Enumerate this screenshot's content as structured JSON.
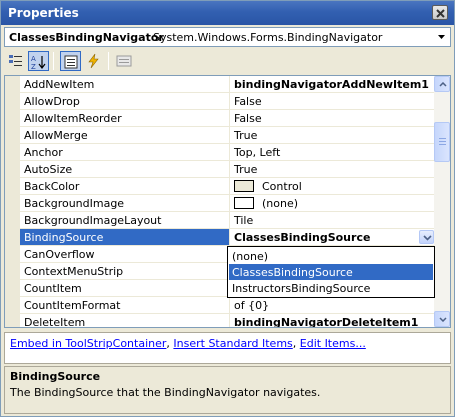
{
  "window": {
    "title": "Properties"
  },
  "object_selector": {
    "name": "ClassesBindingNavigator",
    "type": "System.Windows.Forms.BindingNavigator"
  },
  "toolbar": {
    "buttons": [
      "categorized-icon",
      "alphabetical-icon",
      "properties-icon",
      "events-icon",
      "property-pages-icon"
    ]
  },
  "properties": [
    {
      "name": "AddNewItem",
      "value": "bindingNavigatorAddNewItem1",
      "bold": true
    },
    {
      "name": "AllowDrop",
      "value": "False"
    },
    {
      "name": "AllowItemReorder",
      "value": "False"
    },
    {
      "name": "AllowMerge",
      "value": "True"
    },
    {
      "name": "Anchor",
      "value": "Top, Left"
    },
    {
      "name": "AutoSize",
      "value": "True"
    },
    {
      "name": "BackColor",
      "value": "Control",
      "swatch": "#ece9d8"
    },
    {
      "name": "BackgroundImage",
      "value": "(none)",
      "swatch": "#ffffff"
    },
    {
      "name": "BackgroundImageLayout",
      "value": "Tile"
    },
    {
      "name": "BindingSource",
      "value": "ClassesBindingSource",
      "bold": true,
      "selected": true
    },
    {
      "name": "CanOverflow",
      "value": ""
    },
    {
      "name": "ContextMenuStrip",
      "value": ""
    },
    {
      "name": "CountItem",
      "value": ""
    },
    {
      "name": "CountItemFormat",
      "value": "of {0}"
    },
    {
      "name": "DeleteItem",
      "value": "bindingNavigatorDeleteItem1",
      "bold": true
    }
  ],
  "dropdown": {
    "options": [
      "(none)",
      "ClassesBindingSource",
      "InstructorsBindingSource"
    ],
    "selected": "ClassesBindingSource"
  },
  "verbs": [
    "Embed in ToolStripContainer",
    "Insert Standard Items",
    "Edit Items..."
  ],
  "description": {
    "title": "BindingSource",
    "text": "The BindingSource that the BindingNavigator navigates."
  },
  "colors": {
    "selection": "#316ac5",
    "link": "#0000ff",
    "titlebar": "#3260b1"
  }
}
